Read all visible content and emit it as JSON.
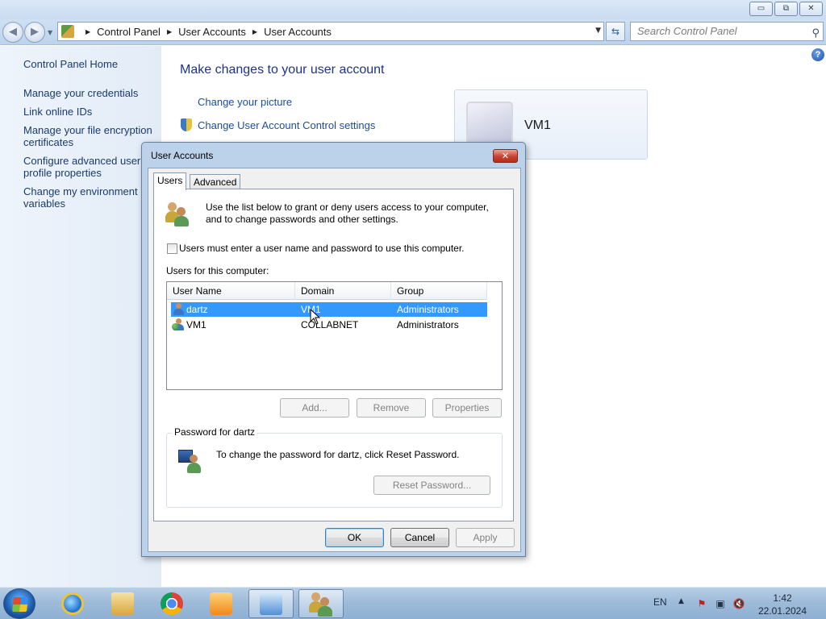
{
  "window": {
    "controls": {
      "minimize": "▭",
      "maximize": "⧉",
      "close": "✕"
    }
  },
  "address": {
    "back_icon": "back-arrow-icon",
    "forward_icon": "forward-arrow-icon",
    "breadcrumbs": [
      "Control Panel",
      "User Accounts",
      "User Accounts"
    ],
    "search_placeholder": "Search Control Panel"
  },
  "sidebar": {
    "items": [
      {
        "label": "Control Panel Home"
      },
      {
        "label": "Manage your credentials"
      },
      {
        "label": "Link online IDs"
      },
      {
        "label": "Manage your file encryption certificates"
      },
      {
        "label": "Configure advanced user profile properties"
      },
      {
        "label": "Change my environment variables"
      }
    ]
  },
  "main": {
    "title": "Make changes to your user account",
    "links": [
      {
        "label": "Change your picture"
      },
      {
        "label": "Change User Account Control settings"
      }
    ],
    "user_tile": {
      "name": "VM1"
    }
  },
  "dialog": {
    "title": "User Accounts",
    "close_label": "✕",
    "tabs": [
      {
        "label": "Users",
        "active": true
      },
      {
        "label": "Advanced",
        "active": false
      }
    ],
    "intro_text_1": "Use the list below to grant or deny users access to your computer,",
    "intro_text_2": "and to change passwords and other settings.",
    "checkbox_label": "Users must enter a user name and password to use this computer.",
    "checkbox_checked": false,
    "users_label": "Users for this computer:",
    "columns": [
      "User Name",
      "Domain",
      "Group"
    ],
    "rows": [
      {
        "user": "dartz",
        "domain": "VM1",
        "group": "Administrators",
        "selected": true
      },
      {
        "user": "VM1",
        "domain": "COLLABNET",
        "group": "Administrators",
        "selected": false
      }
    ],
    "buttons": {
      "add": "Add...",
      "remove": "Remove",
      "properties": "Properties",
      "reset_password": "Reset Password...",
      "ok": "OK",
      "cancel": "Cancel",
      "apply": "Apply"
    },
    "password_group_label": "Password for dartz",
    "password_text": "To change the password for dartz, click Reset Password."
  },
  "taskbar": {
    "pinned": [
      "internet-explorer-icon",
      "file-explorer-icon",
      "chrome-icon",
      "media-player-icon",
      "control-panel-icon",
      "user-accounts-icon"
    ],
    "language": "EN",
    "time": "1:42",
    "date": "22.01.2024"
  },
  "colors": {
    "selection": "#3399ff",
    "link": "#1e4c9a",
    "title": "#1e3287"
  }
}
